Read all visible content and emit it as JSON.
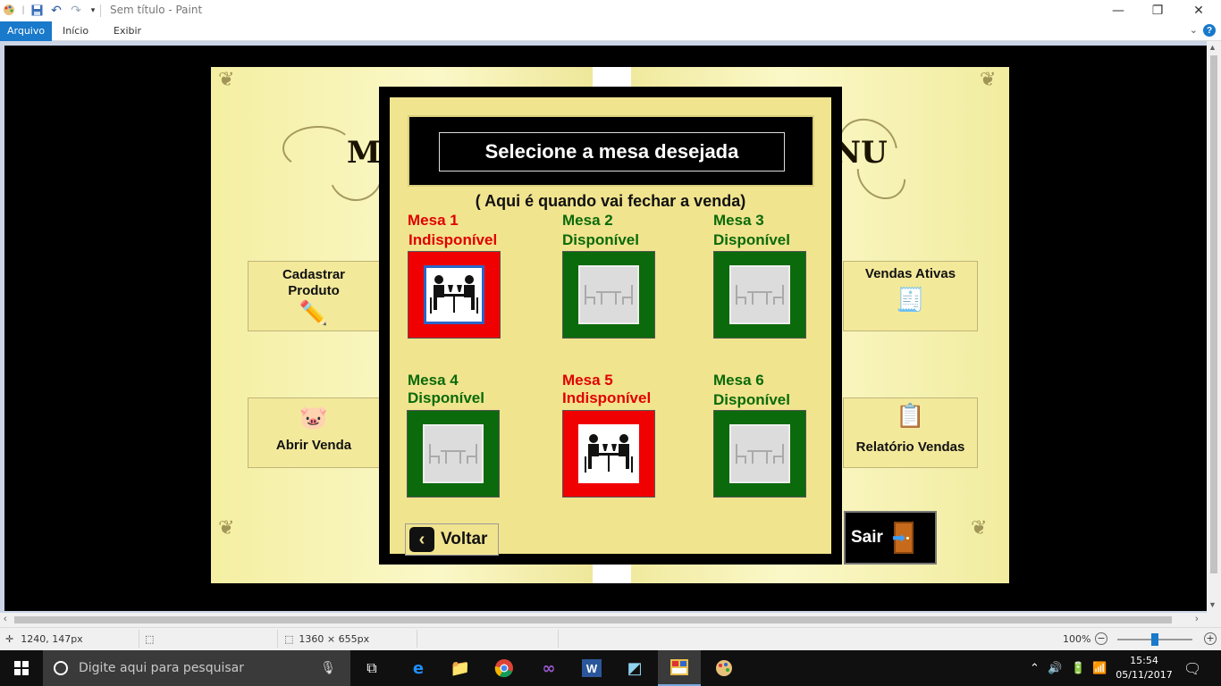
{
  "window": {
    "title": "Sem título - Paint",
    "controls": {
      "minimize": "—",
      "maximize": "❐",
      "close": "✕"
    }
  },
  "ribbon": {
    "tabs": [
      {
        "label": "Arquivo",
        "active": true
      },
      {
        "label": "Início"
      },
      {
        "label": "Exibir"
      }
    ]
  },
  "app": {
    "title_left": "ME",
    "title_right": "NU",
    "menu_buttons": {
      "cadastrar": "Cadastrar Produto",
      "abrir": "Abrir Venda",
      "vendas_ativas": "Vendas Ativas",
      "relatorio": "Relatório Vendas",
      "sair": "Sair"
    },
    "dialog": {
      "header": "Selecione a mesa desejada",
      "subtitle": "( Aqui é quando vai fechar a venda)",
      "back": "Voltar",
      "tables": [
        {
          "name": "Mesa 1",
          "status": "Indisponível",
          "available": false
        },
        {
          "name": "Mesa 2",
          "status": "Disponível",
          "available": true
        },
        {
          "name": "Mesa 3",
          "status": "Disponível",
          "available": true
        },
        {
          "name": "Mesa 4",
          "status": "Disponível",
          "available": true
        },
        {
          "name": "Mesa 5",
          "status": "Indisponível",
          "available": false
        },
        {
          "name": "Mesa 6",
          "status": "Disponível",
          "available": true
        }
      ]
    }
  },
  "statusbar": {
    "cursor": "1240, 147px",
    "image_size": "1360 × 655px",
    "zoom": "100%"
  },
  "taskbar": {
    "search_placeholder": "Digite aqui para pesquisar",
    "time": "15:54",
    "date": "05/11/2017"
  },
  "colors": {
    "available": "#0b6a0b",
    "unavailable": "#f00000",
    "dialog_bg": "#f1e48e",
    "accent": "#1979ca"
  }
}
